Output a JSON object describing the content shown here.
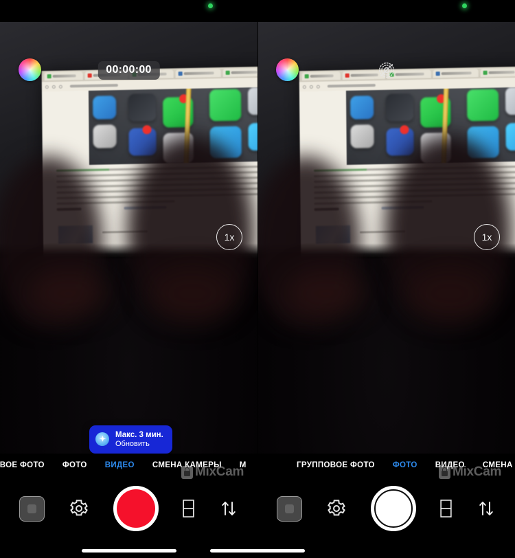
{
  "app": {
    "name": "MixCam",
    "watermark_label": "MixCam",
    "watermark_icon": "lock-icon"
  },
  "panels": [
    {
      "id": "left",
      "active_mode": "ВИДЕО",
      "topbar": {
        "filter_icon": "color-wheel-icon",
        "timer_label": "00:00:00",
        "recording_indicator": "green-dot"
      },
      "zoom_badge": "1x",
      "toast": {
        "icon": "sparkle-icon",
        "title": "Макс. 3 мин.",
        "subtitle": "Обновить",
        "background": "#1727d6"
      },
      "modes": [
        {
          "label": "ГРУППОВОЕ ФОТО",
          "active": false
        },
        {
          "label": "ФОТО",
          "active": false
        },
        {
          "label": "ВИДЕО",
          "active": true
        },
        {
          "label": "СМЕНА КАМЕРЫ",
          "active": false
        },
        {
          "label": "М",
          "active": false
        }
      ],
      "controls": {
        "gallery_label": "gallery-thumbnail",
        "settings_label": "settings-gear",
        "shutter_label": "record-button",
        "shutter_kind": "record",
        "layout_label": "split-layout",
        "swap_label": "swap-cameras"
      }
    },
    {
      "id": "right",
      "active_mode": "ФОТО",
      "topbar": {
        "filter_icon": "color-wheel-icon",
        "flash_icon": "flash-off-icon",
        "recording_indicator": "green-dot"
      },
      "zoom_badge": "1x",
      "modes": [
        {
          "label": "ГРУППОВОЕ ФОТО",
          "active": false
        },
        {
          "label": "ФОТО",
          "active": true
        },
        {
          "label": "ВИДЕО",
          "active": false
        },
        {
          "label": "СМЕНА КАМ",
          "active": false
        }
      ],
      "controls": {
        "gallery_label": "gallery-thumbnail",
        "settings_label": "settings-gear",
        "shutter_label": "photo-button",
        "shutter_kind": "photo",
        "layout_label": "split-layout",
        "swap_label": "swap-cameras"
      }
    }
  ],
  "colors": {
    "accent_blue": "#2e8cf0",
    "record_red": "#f5112b",
    "toast_blue": "#1727d6",
    "indicator_green": "#2fd45f"
  }
}
